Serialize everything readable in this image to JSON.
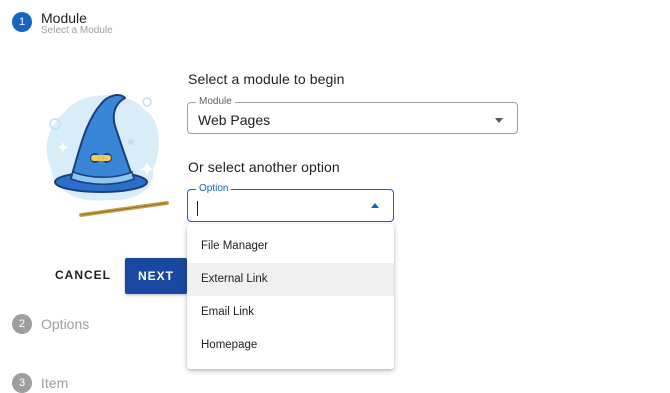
{
  "stepper": {
    "steps": [
      {
        "number": "1",
        "title": "Module",
        "subtitle": "Select a Module"
      },
      {
        "number": "2",
        "title": "Options"
      },
      {
        "number": "3",
        "title": "Item"
      }
    ]
  },
  "main": {
    "heading_module": "Select a module to begin",
    "module_field": {
      "label": "Module",
      "value": "Web Pages"
    },
    "heading_option": "Or select another option",
    "option_field": {
      "label": "Option",
      "value": ""
    }
  },
  "dropdown": {
    "items": [
      "File Manager",
      "External Link",
      "Email Link",
      "Homepage"
    ]
  },
  "actions": {
    "cancel_label": "CANCEL",
    "next_label": "NEXT"
  },
  "colors": {
    "primary": "#1565c0",
    "next_button": "#1a47a0",
    "inactive_step": "#9e9e9e"
  },
  "icons": {
    "illustration": "wizard-hat-and-wand-illustration"
  }
}
